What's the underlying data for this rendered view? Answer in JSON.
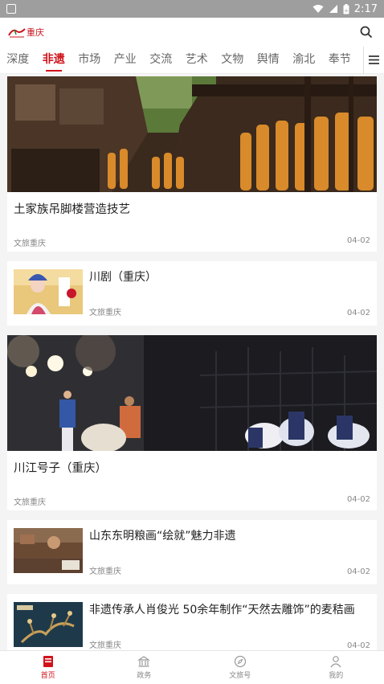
{
  "status_bar": {
    "time": "2:17",
    "icons": [
      "wifi-icon",
      "signal-icon",
      "battery-icon"
    ]
  },
  "app": {
    "logo_text": "重庆",
    "colors": {
      "brand": "#d0121b"
    }
  },
  "tabs": [
    {
      "label": "深度"
    },
    {
      "label": "非遗",
      "active": true
    },
    {
      "label": "市场"
    },
    {
      "label": "产业"
    },
    {
      "label": "交流"
    },
    {
      "label": "艺术"
    },
    {
      "label": "文物"
    },
    {
      "label": "舆情"
    },
    {
      "label": "渝北"
    },
    {
      "label": "奉节"
    }
  ],
  "feed": [
    {
      "type": "big",
      "title": "土家族吊脚楼营造技艺",
      "source": "文旅重庆",
      "date": "04-02"
    },
    {
      "type": "small",
      "title": "川剧（重庆）",
      "source": "文旅重庆",
      "date": "04-02"
    },
    {
      "type": "big",
      "title": "川江号子（重庆）",
      "source": "文旅重庆",
      "date": "04-02"
    },
    {
      "type": "small",
      "title": "山东东明粮画“绘就”魅力非遗",
      "source": "文旅重庆",
      "date": "04-02"
    },
    {
      "type": "small",
      "title": "非遗传承人肖俊光 50余年制作“天然去雕饰”的麦秸画",
      "source": "文旅重庆",
      "date": "04-02"
    }
  ],
  "bottom_nav": [
    {
      "label": "首页",
      "icon": "home-icon",
      "active": true
    },
    {
      "label": "政务",
      "icon": "government-icon"
    },
    {
      "label": "文旅号",
      "icon": "compass-icon"
    },
    {
      "label": "我的",
      "icon": "user-icon"
    }
  ]
}
